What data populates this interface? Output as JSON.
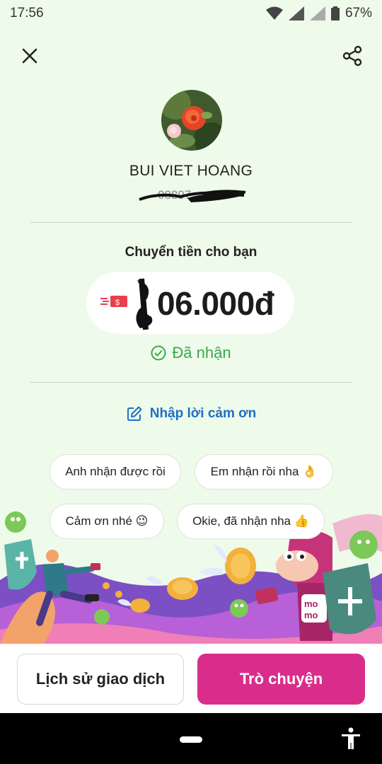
{
  "status_bar": {
    "time": "17:56",
    "battery": "67%"
  },
  "recipient": {
    "name": "BUI VIET HOANG",
    "phone_masked": "08897"
  },
  "transfer": {
    "title": "Chuyển tiền cho bạn",
    "amount": "06.000đ",
    "status": "Đã nhận"
  },
  "thanks": {
    "link_label": "Nhập lời cảm ơn",
    "suggestions": [
      "Anh nhận được rồi",
      "Em nhận rồi nha 👌",
      "Cảm ơn nhé 😉",
      "Okie, đã nhận nha 👍"
    ]
  },
  "actions": {
    "history_label": "Lịch sử giao dịch",
    "chat_label": "Trò chuyện"
  },
  "colors": {
    "background": "#eefaea",
    "accent": "#d82d8b",
    "success": "#3aa84a",
    "link": "#1f6fc6"
  },
  "icons": [
    "wifi-icon",
    "signal-icon",
    "battery-icon",
    "close-icon",
    "share-icon",
    "money-icon",
    "check-circle-icon",
    "edit-icon",
    "accessibility-icon"
  ]
}
